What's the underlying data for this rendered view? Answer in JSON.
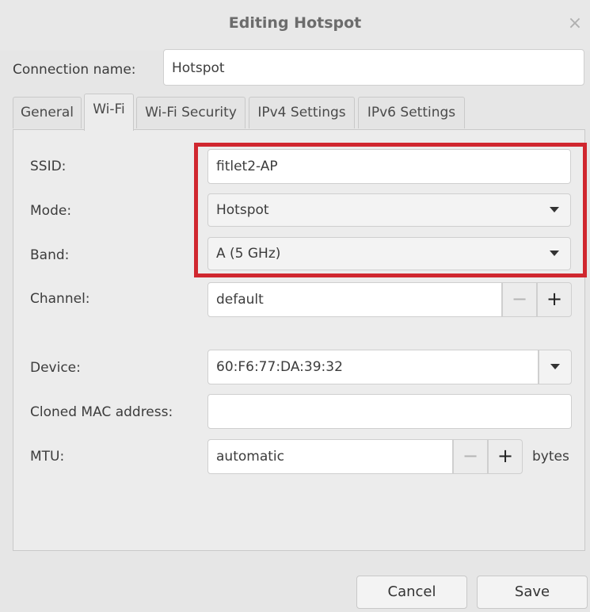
{
  "window": {
    "title": "Editing Hotspot",
    "close_glyph": "×"
  },
  "connection": {
    "label": "Connection name:",
    "value": "Hotspot"
  },
  "tabs": [
    {
      "label": "General",
      "active": false
    },
    {
      "label": "Wi-Fi",
      "active": true
    },
    {
      "label": "Wi-Fi Security",
      "active": false
    },
    {
      "label": "IPv4 Settings",
      "active": false
    },
    {
      "label": "IPv6 Settings",
      "active": false
    }
  ],
  "wifi": {
    "ssid": {
      "label": "SSID:",
      "value": "fitlet2-AP"
    },
    "mode": {
      "label": "Mode:",
      "value": "Hotspot"
    },
    "band": {
      "label": "Band:",
      "value": "A (5 GHz)"
    },
    "channel": {
      "label": "Channel:",
      "value": "default",
      "minus": "−",
      "plus": "+"
    },
    "device": {
      "label": "Device:",
      "value": "60:F6:77:DA:39:32"
    },
    "cloned_mac": {
      "label": "Cloned MAC address:",
      "value": ""
    },
    "mtu": {
      "label": "MTU:",
      "value": "automatic",
      "minus": "−",
      "plus": "+",
      "unit": "bytes"
    }
  },
  "footer": {
    "cancel": "Cancel",
    "save": "Save"
  },
  "colors": {
    "highlight": "#d0272f"
  }
}
